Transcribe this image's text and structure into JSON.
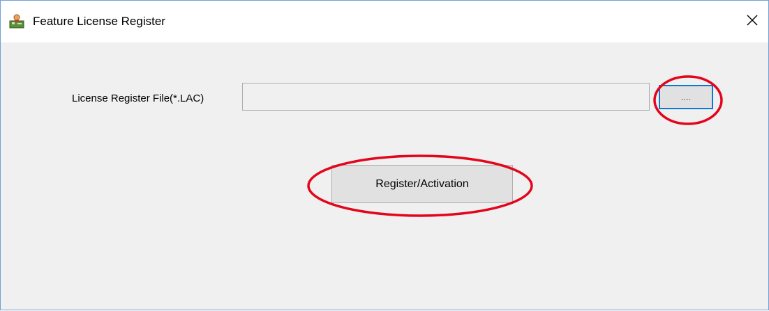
{
  "window": {
    "title": "Feature License Register",
    "icon": "license-register-app-icon",
    "close_icon": "close-icon"
  },
  "form": {
    "file_label": "License Register File(*.LAC)",
    "file_value": "",
    "browse_label": "....",
    "register_label": "Register/Activation"
  },
  "colors": {
    "highlight": "#e3051b",
    "focus_border": "#0a78d7",
    "window_border": "#6e9fd6"
  }
}
